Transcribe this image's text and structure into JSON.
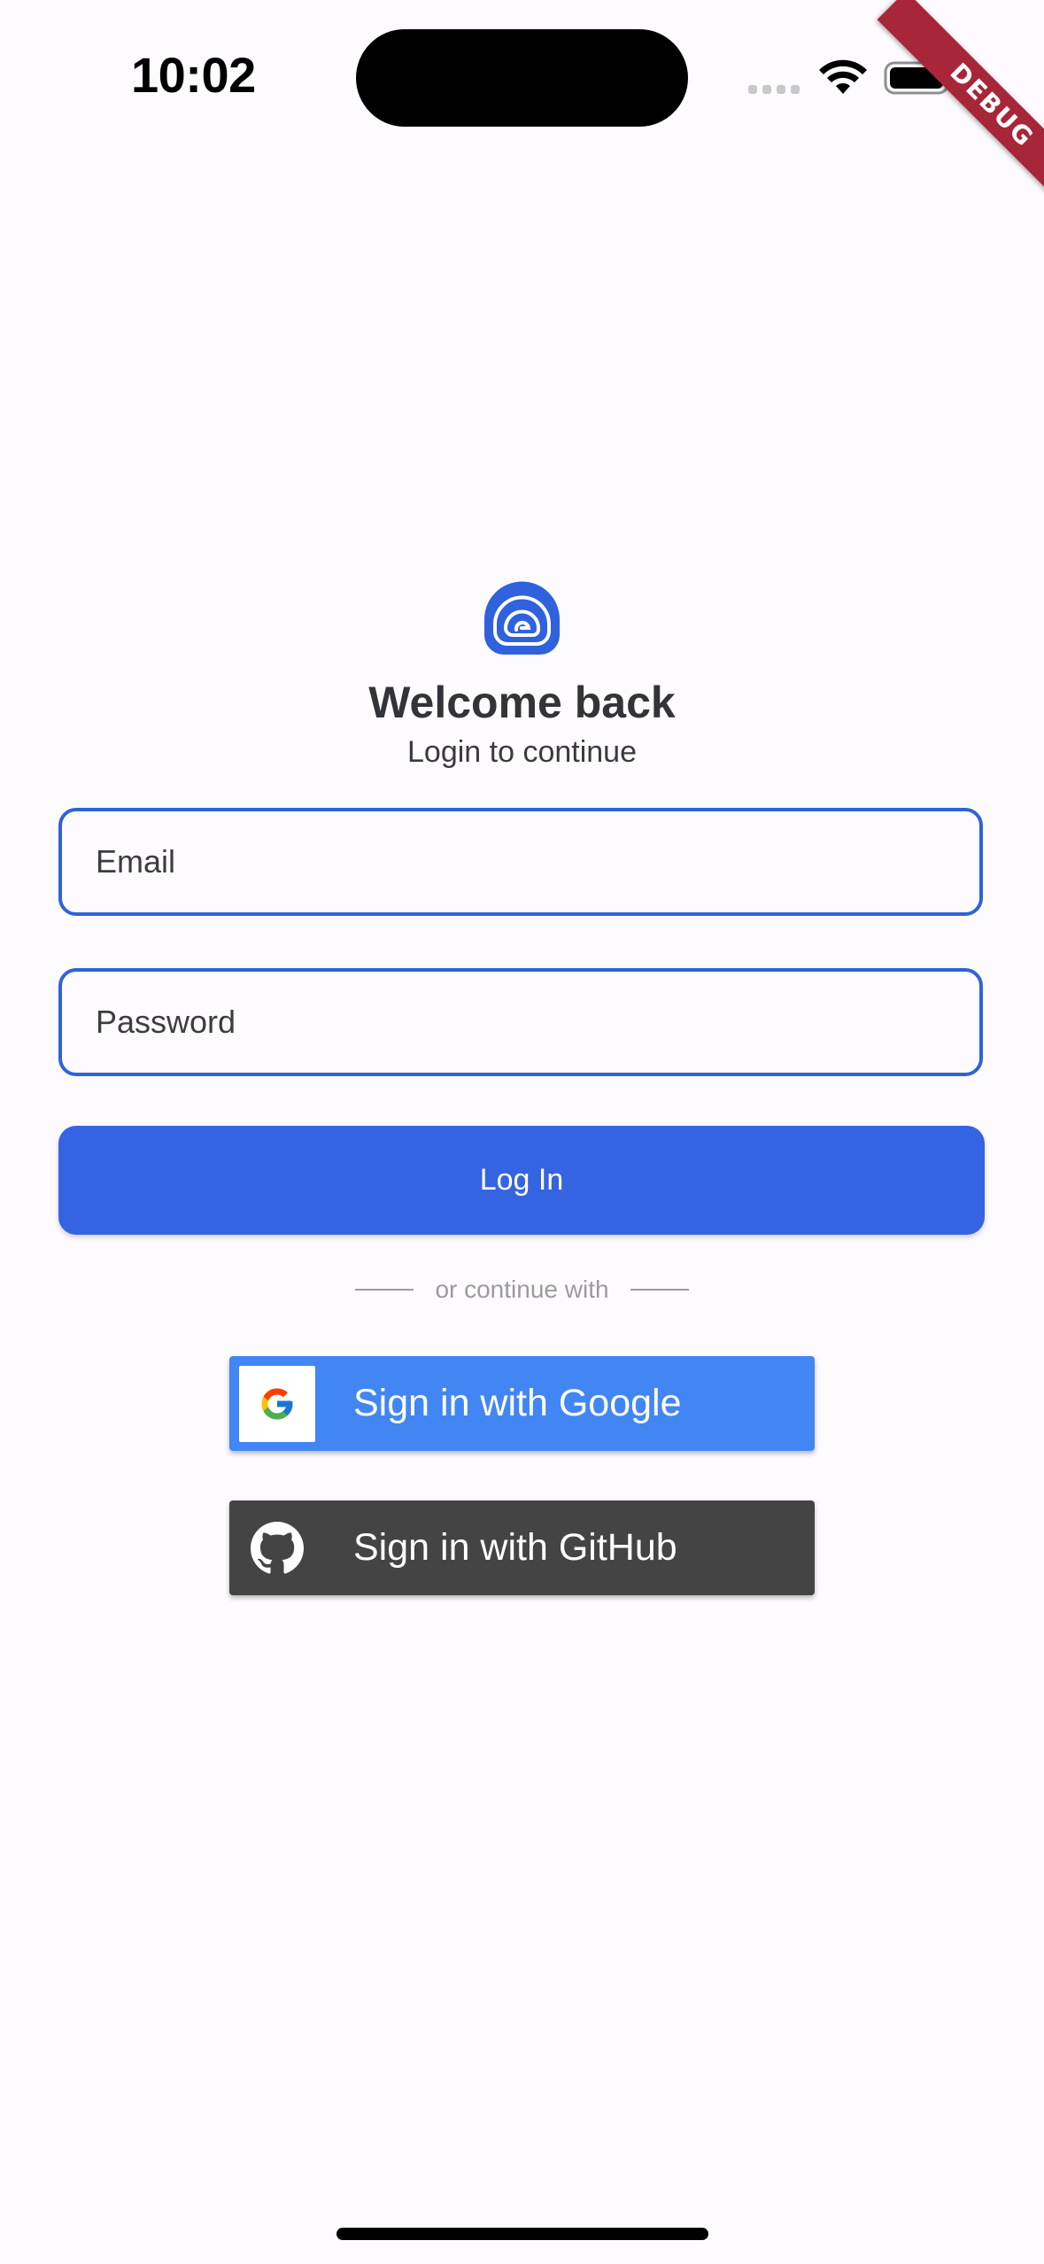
{
  "status_bar": {
    "time": "10:02"
  },
  "debug_ribbon": {
    "label": "DEBUG"
  },
  "header": {
    "title": "Welcome back",
    "subtitle": "Login to continue"
  },
  "form": {
    "email_placeholder": "Email",
    "password_placeholder": "Password",
    "login_label": "Log In"
  },
  "divider": {
    "label": "or continue with"
  },
  "social": {
    "google_label": "Sign in with Google",
    "github_label": "Sign in with GitHub"
  },
  "colors": {
    "primary": "#3564e3",
    "field_border": "#2f63d8",
    "google": "#4286f4",
    "github": "#444444",
    "background": "#fefbfe",
    "debug_ribbon": "#a8263a"
  },
  "icons": {
    "logo": "app-logo-icon",
    "google": "google-g-icon",
    "github": "github-octocat-icon",
    "wifi": "wifi-icon",
    "battery": "battery-icon"
  }
}
